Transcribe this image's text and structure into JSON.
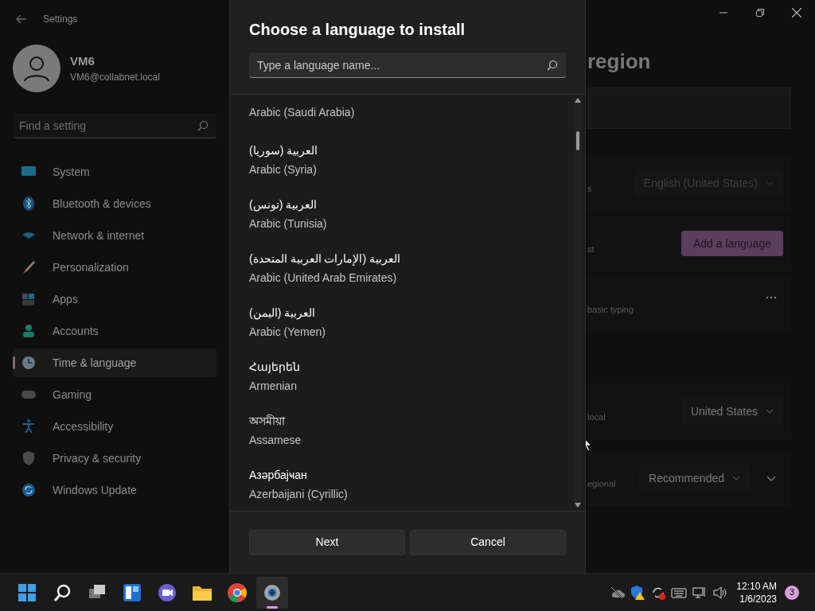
{
  "window": {
    "title": "Settings"
  },
  "user": {
    "name": "VM6",
    "email": "VM6@collabnet.local"
  },
  "search": {
    "placeholder": "Find a setting"
  },
  "nav": [
    {
      "label": "System",
      "selected": false
    },
    {
      "label": "Bluetooth & devices",
      "selected": false
    },
    {
      "label": "Network & internet",
      "selected": false
    },
    {
      "label": "Personalization",
      "selected": false
    },
    {
      "label": "Apps",
      "selected": false
    },
    {
      "label": "Accounts",
      "selected": false
    },
    {
      "label": "Time & language",
      "selected": true
    },
    {
      "label": "Gaming",
      "selected": false
    },
    {
      "label": "Accessibility",
      "selected": false
    },
    {
      "label": "Privacy & security",
      "selected": false
    },
    {
      "label": "Windows Update",
      "selected": false
    }
  ],
  "page": {
    "title": "region",
    "rows": [
      {
        "kind": "dropdown",
        "label": "s",
        "value": "English (United States)",
        "disabled": true
      },
      {
        "kind": "button",
        "label": "st",
        "button": "Add a language"
      },
      {
        "kind": "more",
        "label": "basic typing"
      },
      {
        "kind": "dropdown",
        "label": "local",
        "value": "United States",
        "disabled": false
      },
      {
        "kind": "expander",
        "label": "egional",
        "value": "Recommended",
        "disabled": false
      }
    ]
  },
  "dialog": {
    "title": "Choose a language to install",
    "search_placeholder": "Type a language name...",
    "languages": [
      {
        "english": "Arabic (Saudi Arabia)"
      },
      {
        "native": "العربية (سوريا)",
        "english": "Arabic (Syria)"
      },
      {
        "native": "العربية (تونس)",
        "english": "Arabic (Tunisia)"
      },
      {
        "native": "العربية (الإمارات العربية المتحدة)",
        "english": "Arabic (United Arab Emirates)"
      },
      {
        "native": "العربية (اليمن)",
        "english": "Arabic (Yemen)"
      },
      {
        "native": "Հայերեն",
        "english": "Armenian"
      },
      {
        "native": "অসমীয়া",
        "english": "Assamese"
      },
      {
        "native": "Азәрбајҹан",
        "english": "Azerbaijani (Cyrillic)"
      }
    ],
    "buttons": [
      "Next",
      "Cancel"
    ]
  },
  "taskbar": {
    "time": "12:10 AM",
    "date": "1/6/2023",
    "notifications": "3"
  }
}
